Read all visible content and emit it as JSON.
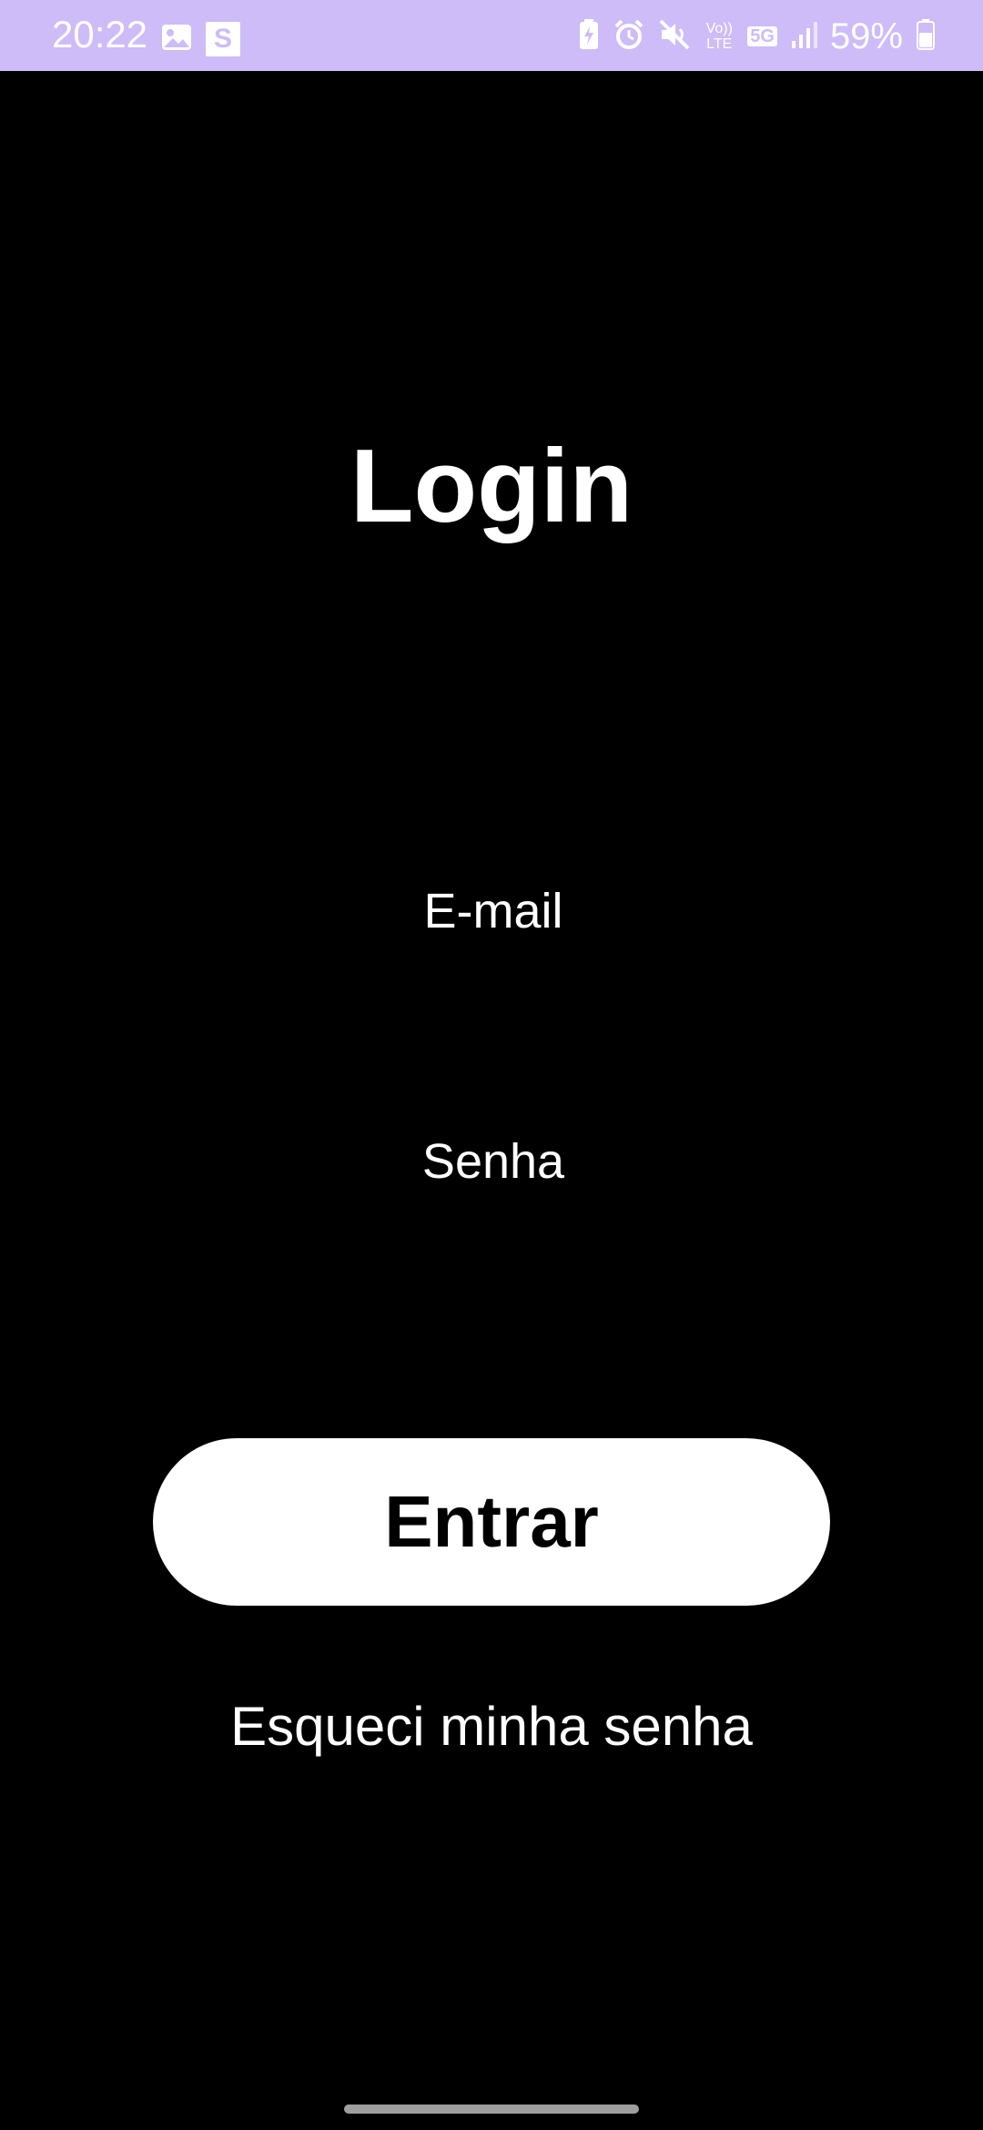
{
  "status_bar": {
    "time": "20:22",
    "battery_percent": "59%",
    "background_color": "#cdbcf7",
    "left_icons": [
      "image-icon",
      "s-app-icon"
    ],
    "s_badge_text": "S",
    "right_icons": [
      "battery-saver-icon",
      "alarm-icon",
      "mute-icon",
      "volte-icon",
      "5g-icon",
      "signal-icon",
      "battery-icon"
    ],
    "volte_text": "Vo)) LTE",
    "network_text": "5G"
  },
  "login": {
    "title": "Login",
    "email_placeholder": "E-mail",
    "password_placeholder": "Senha",
    "submit_label": "Entrar",
    "forgot_label": "Esqueci minha senha"
  },
  "colors": {
    "background": "#000000",
    "text": "#ffffff",
    "button_background": "#ffffff",
    "button_text": "#000000"
  }
}
